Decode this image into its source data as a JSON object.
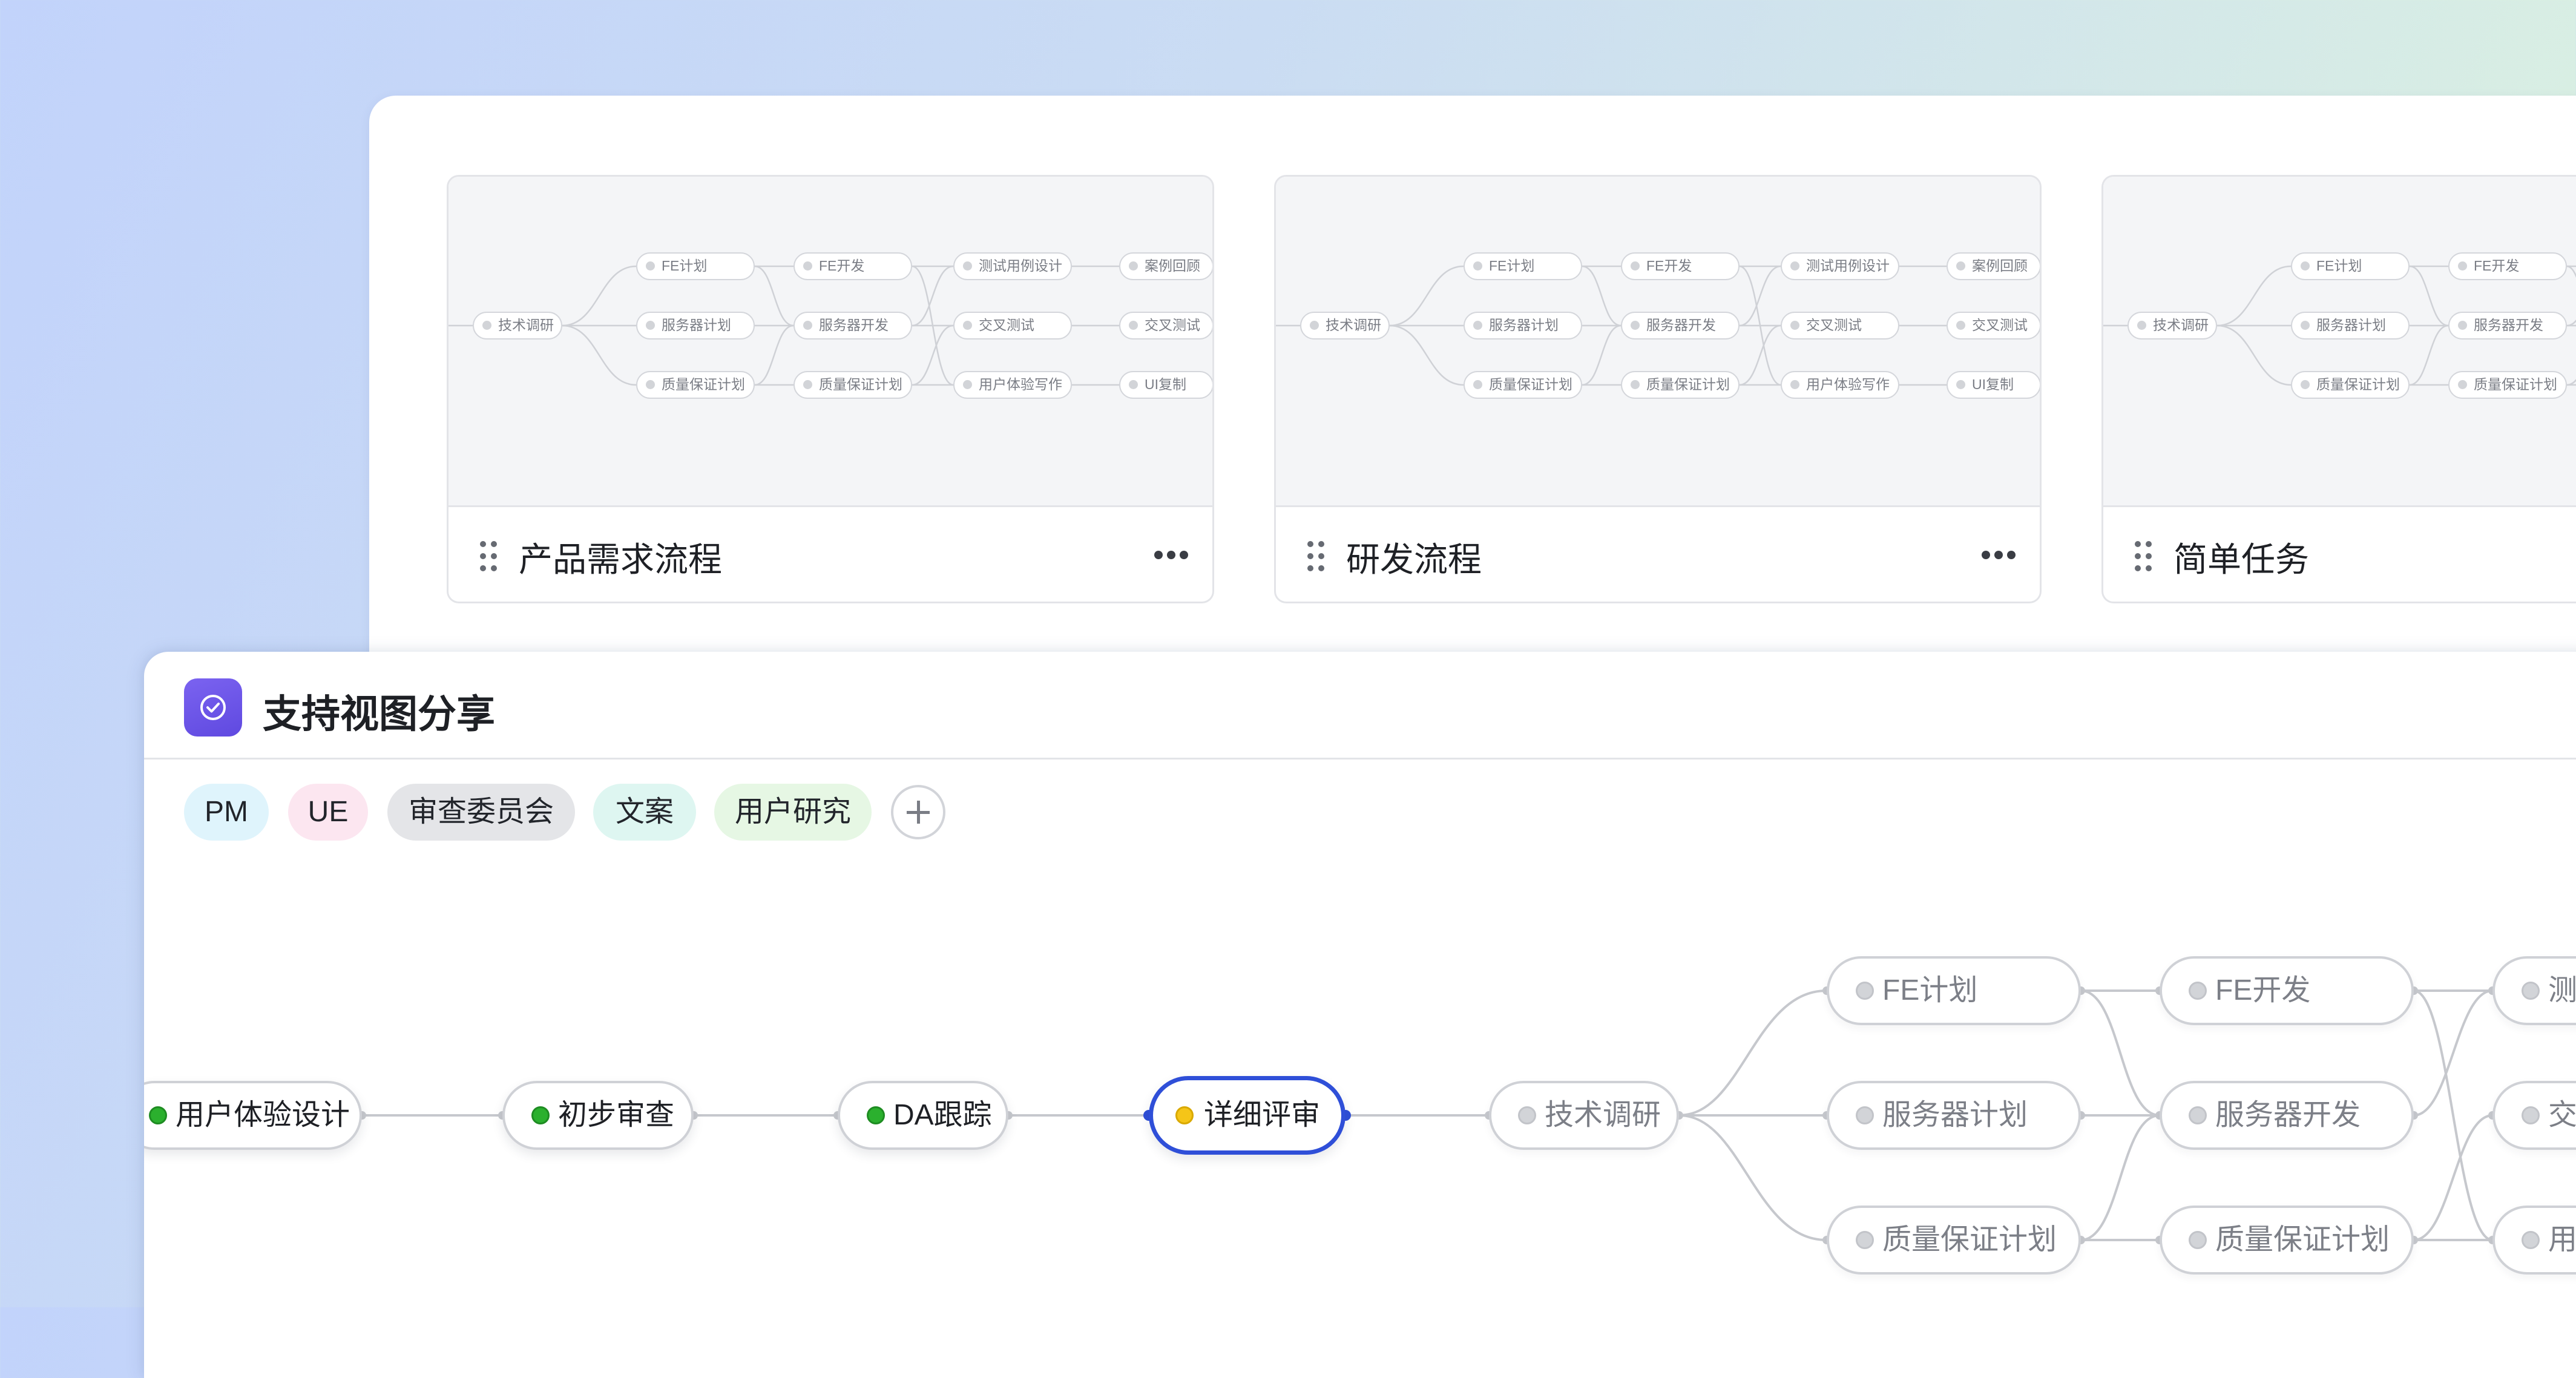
{
  "templates": {
    "cards": [
      {
        "title": "产品需求流程",
        "more_icon": "more-horizontal-icon"
      },
      {
        "title": "研发流程",
        "more_icon": "more-horizontal-icon"
      },
      {
        "title": "简单任务",
        "more_icon": "more-horizontal-icon"
      }
    ],
    "preview_nodes": {
      "col1": [
        "技术调研"
      ],
      "col2": [
        "FE计划",
        "服务器计划",
        "质量保证计划"
      ],
      "col3": [
        "FE开发",
        "服务器开发",
        "质量保证计划"
      ],
      "col4": [
        "测试用例设计",
        "交叉测试",
        "用户体验写作"
      ],
      "col5": [
        "案例回顾",
        "交叉测试",
        "UI复制"
      ]
    }
  },
  "view": {
    "title": "支持视图分享",
    "icon": "check-circle-icon",
    "tags": [
      {
        "label": "PM",
        "color": "#dff4fc"
      },
      {
        "label": "UE",
        "color": "#fce6f0"
      },
      {
        "label": "审查委员会",
        "color": "#e4e5e8"
      },
      {
        "label": "文案",
        "color": "#def6f1"
      },
      {
        "label": "用户研究",
        "color": "#e6f7e4"
      }
    ],
    "add_tag_icon": "plus-icon",
    "flow": {
      "main": [
        {
          "label": "用户体验设计",
          "status": "done"
        },
        {
          "label": "初步审查",
          "status": "done"
        },
        {
          "label": "DA跟踪",
          "status": "done"
        },
        {
          "label": "详细评审",
          "status": "active"
        },
        {
          "label": "技术调研",
          "status": "pending"
        }
      ],
      "col2": [
        "FE计划",
        "服务器计划",
        "质量保证计划"
      ],
      "col3": [
        "FE开发",
        "服务器开发",
        "质量保证计划"
      ],
      "col4": [
        "测",
        "交",
        "用"
      ],
      "status_colors": {
        "done": "#2bb02e",
        "active": "#f5c518",
        "pending": "#d2d4d8",
        "highlight": "#2f4fd8"
      }
    }
  }
}
